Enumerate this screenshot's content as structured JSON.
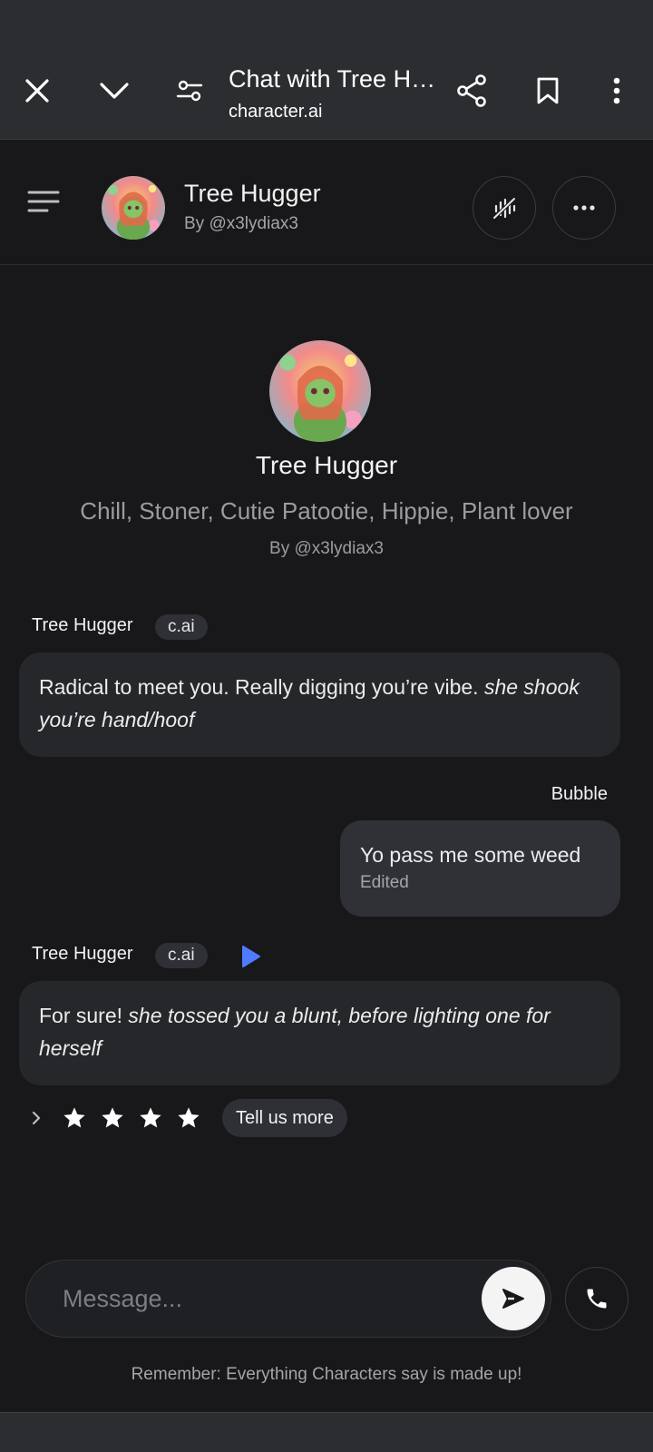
{
  "browser": {
    "title": "Chat with Tree Hugger | character.ai",
    "url": "character.ai"
  },
  "header": {
    "character_name": "Tree Hugger",
    "author": "By @x3lydiax3"
  },
  "intro": {
    "name": "Tree Hugger",
    "tagline": "Chill, Stoner, Cutie Patootie, Hippie, Plant lover",
    "author": "By @x3lydiax3"
  },
  "messages": [
    {
      "sender": "Tree Hugger",
      "badge": "c.ai",
      "text_plain": "Radical to meet you. Really digging you’re vibe. ",
      "text_action": "she shook you’re hand/hoof"
    },
    {
      "sender": "Bubble",
      "text": "Yo pass me some weed",
      "status": "Edited"
    },
    {
      "sender": "Tree Hugger",
      "badge": "c.ai",
      "text_plain": "For sure! ",
      "text_action": "she tossed you a blunt, before lighting one for herself"
    }
  ],
  "rating": {
    "stars_filled": 4,
    "tell_more_label": "Tell us more"
  },
  "composer": {
    "placeholder": "Message..."
  },
  "disclaimer": "Remember: Everything Characters say is made up!",
  "colors": {
    "background": "#18181b",
    "bubble": "#26272b",
    "accent_play": "#4f7bff"
  }
}
